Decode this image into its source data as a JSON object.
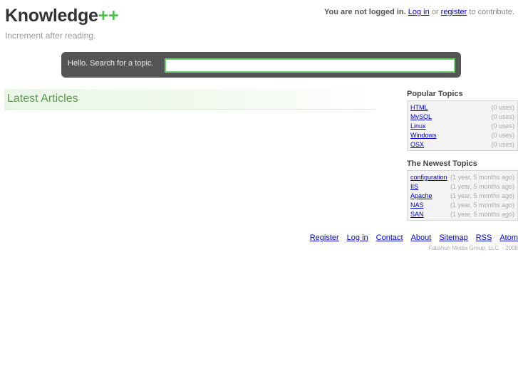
{
  "header": {
    "logo_main": "Knowledge",
    "logo_suffix": "++",
    "tagline": "Increment after reading."
  },
  "login": {
    "status_text": "You are not logged in.",
    "login_label": "Log in",
    "or_text": "or",
    "register_label": "register",
    "suffix_text": "to contribute."
  },
  "search": {
    "label": "Hello. Search for a topic.",
    "value": ""
  },
  "latest": {
    "title": "Latest Articles"
  },
  "popular": {
    "title": "Popular Topics",
    "items": [
      {
        "label": "HTML",
        "count": "(0 uses)"
      },
      {
        "label": "MySQL",
        "count": "(0 uses)"
      },
      {
        "label": "Linux",
        "count": "(0 uses)"
      },
      {
        "label": "Windows",
        "count": "(0 uses)"
      },
      {
        "label": "OSX",
        "count": "(0 uses)"
      }
    ]
  },
  "newest": {
    "title": "The Newest Topics",
    "items": [
      {
        "label": "configuration",
        "age": "(1 year, 5 months ago)"
      },
      {
        "label": "IIS",
        "age": "(1 year, 5 months ago)"
      },
      {
        "label": "Apache",
        "age": "(1 year, 5 months ago)"
      },
      {
        "label": "NAS",
        "age": "(1 year, 5 months ago)"
      },
      {
        "label": "SAN",
        "age": "(1 year, 5 months ago)"
      }
    ]
  },
  "footer": {
    "links": [
      "Register",
      "Log in",
      "Contact",
      "About",
      "Sitemap",
      "RSS",
      "Atom"
    ],
    "copyright": "Fakshun Media Group, LLC. - 2008"
  },
  "colors": {
    "accent_green": "#4fbf4f",
    "search_bg": "#555555",
    "link": "#0000cc"
  }
}
